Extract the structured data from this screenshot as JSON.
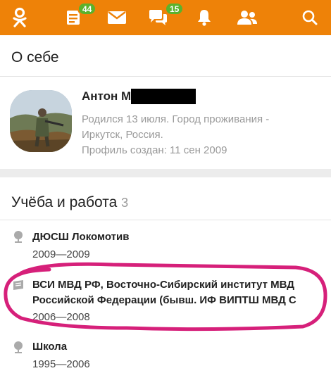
{
  "topbar": {
    "icons": [
      "ok-logo-icon",
      "feed-icon",
      "mail-icon",
      "chat-icon",
      "bell-icon",
      "friends-icon",
      "search-icon"
    ],
    "feed_badge": "44",
    "chat_badge": "15"
  },
  "about": {
    "title": "О себе"
  },
  "profile": {
    "name": "Антон М",
    "birth_line1": "Родился 13 июля. Город проживания -",
    "birth_line2": "Иркутск, Россия.",
    "created": "Профиль создан: 11 сен 2009"
  },
  "education": {
    "title": "Учёба и работа",
    "count": "3",
    "items": [
      {
        "name": "ДЮСШ Локомотив",
        "years": "2009—2009"
      },
      {
        "name1": "ВСИ МВД РФ, Восточно-Сибирский институт МВД",
        "name2": "Российской Федерации (бывш. ИФ ВИПТШ МВД С",
        "years": "2006—2008"
      },
      {
        "name": "Школа",
        "years": "1995—2006"
      }
    ]
  },
  "colors": {
    "accent": "#ee8208",
    "badge": "#5ab22c",
    "annotation": "#d6207a"
  }
}
